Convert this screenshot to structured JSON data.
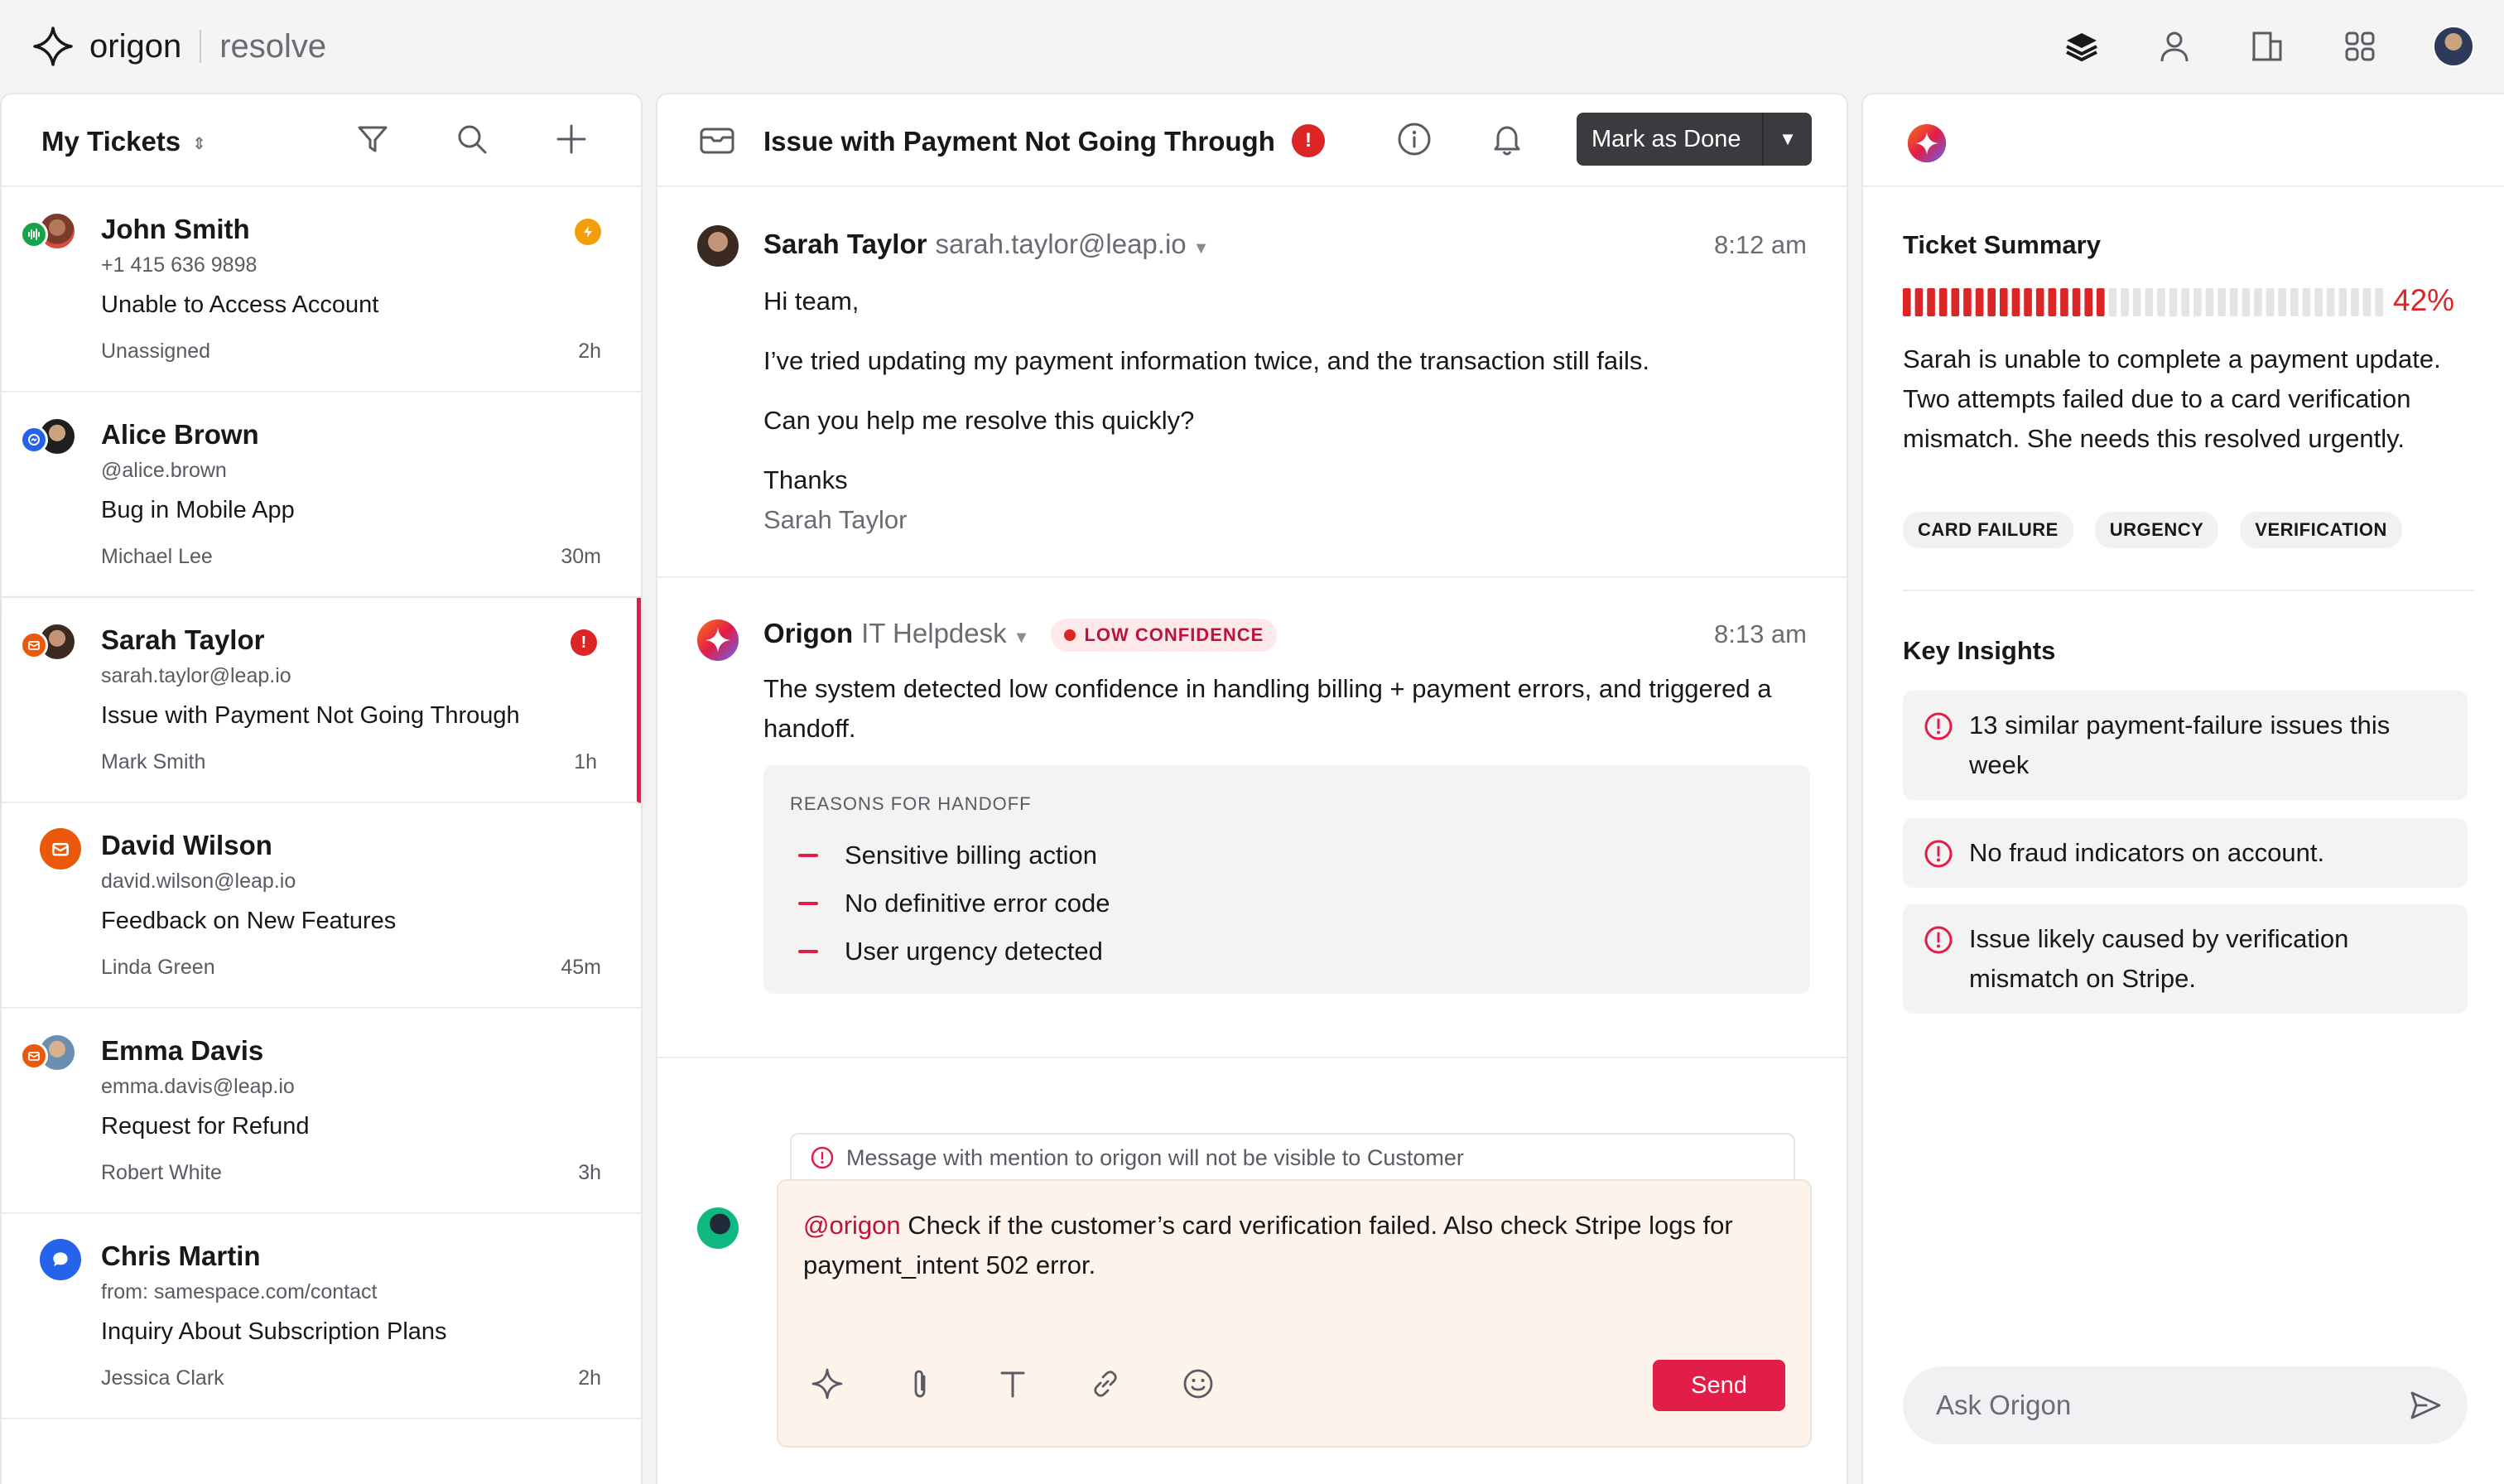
{
  "brand": {
    "name": "origon",
    "product": "resolve"
  },
  "tickets_header": {
    "title": "My Tickets"
  },
  "tickets": [
    {
      "name": "John Smith",
      "sub": "+1 415 636 9898",
      "subject": "Unable to Access Account",
      "assignee": "Unassigned",
      "time": "2h",
      "channel": "voice",
      "flag": "orange"
    },
    {
      "name": "Alice Brown",
      "sub": "@alice.brown",
      "subject": "Bug in Mobile App",
      "assignee": "Michael Lee",
      "time": "30m",
      "channel": "messenger",
      "flag": ""
    },
    {
      "name": "Sarah Taylor",
      "sub": "sarah.taylor@leap.io",
      "subject": "Issue with Payment Not Going Through",
      "assignee": "Mark Smith",
      "time": "1h",
      "channel": "email",
      "flag": "red"
    },
    {
      "name": "David Wilson",
      "sub": "david.wilson@leap.io",
      "subject": "Feedback on New Features",
      "assignee": "Linda Green",
      "time": "45m",
      "channel": "email",
      "flag": ""
    },
    {
      "name": "Emma Davis",
      "sub": "emma.davis@leap.io",
      "subject": "Request for Refund",
      "assignee": "Robert White",
      "time": "3h",
      "channel": "email",
      "flag": ""
    },
    {
      "name": "Chris Martin",
      "sub": "from: samespace.com/contact",
      "subject": "Inquiry About Subscription Plans",
      "assignee": "Jessica Clark",
      "time": "2h",
      "channel": "chat",
      "flag": ""
    }
  ],
  "conversation": {
    "title": "Issue with Payment Not Going Through",
    "mark_done": "Mark as Done",
    "message1": {
      "sender": "Sarah Taylor",
      "email": "sarah.taylor@leap.io",
      "time": "8:12 am",
      "lines": [
        "Hi team,",
        "I’ve tried updating my payment information twice, and the transaction still fails.",
        "Can you help me resolve this quickly?"
      ],
      "signoff": "Thanks",
      "signature": "Sarah Taylor"
    },
    "message2": {
      "sender": "Origon",
      "team": "IT Helpdesk",
      "badge": "LOW CONFIDENCE",
      "time": "8:13 am",
      "text": "The system detected low confidence in handling billing + payment errors, and triggered a handoff.",
      "reasons_title": "REASONS FOR HANDOFF",
      "reasons": [
        "Sensitive billing action",
        "No definitive error code",
        "User urgency detected"
      ]
    },
    "composer": {
      "notice": "Message with mention to origon will not be visible to Customer",
      "mention": "@origon",
      "text": " Check if the customer’s card verification failed. Also check Stripe logs for payment_intent 502 error.",
      "send": "Send"
    }
  },
  "summary": {
    "title": "Ticket Summary",
    "progress": 0.42,
    "percent": "42%",
    "text": "Sarah is unable to complete a payment update. Two attempts failed due to a card verification mismatch. She needs this resolved urgently.",
    "tags": [
      "CARD FAILURE",
      "URGENCY",
      "VERIFICATION"
    ]
  },
  "insights": {
    "title": "Key Insights",
    "items": [
      "13 similar payment-failure issues this week",
      "No fraud indicators on account.",
      "Issue likely caused by verification mismatch on Stripe."
    ]
  },
  "ask": {
    "placeholder": "Ask Origon"
  },
  "colors": {
    "accent": "#e11d48",
    "alert": "#dc2626",
    "dark_button": "#3a3a3f"
  }
}
